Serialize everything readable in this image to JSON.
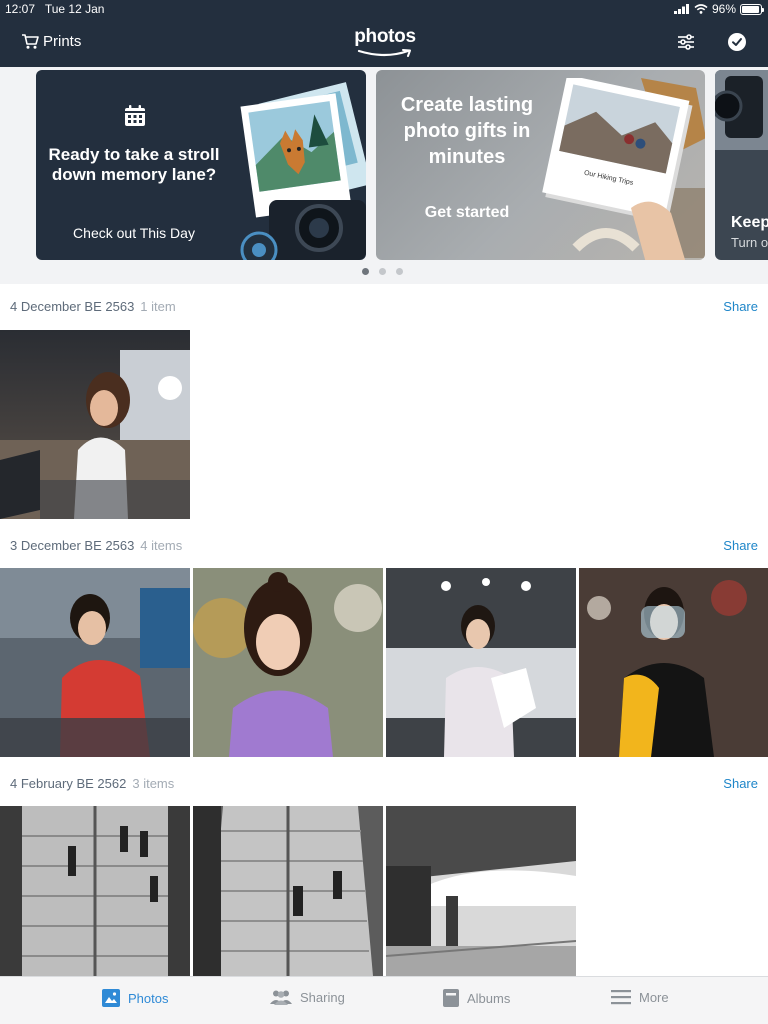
{
  "status_bar": {
    "time": "12:07",
    "date": "Tue 12 Jan",
    "battery": "96%",
    "battery_level": 0.96
  },
  "header": {
    "prints_label": "Prints",
    "logo_text": "photos",
    "filter_icon": "sliders-icon",
    "select_icon": "check-circle-icon",
    "accent": "#232f3e"
  },
  "carousel": {
    "cards": [
      {
        "title": "Ready to take a stroll down memory lane?",
        "link": "Check out This Day",
        "icon": "calendar-icon"
      },
      {
        "title": "Create lasting photo gifts in minutes",
        "link": "Get started",
        "book_title": "Our Hiking Trips"
      },
      {
        "title": "Keep",
        "subtitle": "Turn o"
      }
    ],
    "page_count": 3,
    "active_page": 1
  },
  "sections": [
    {
      "date": "4 December BE 2563",
      "count": "1 item",
      "share": "Share"
    },
    {
      "date": "3 December BE 2563",
      "count": "4 items",
      "share": "Share"
    },
    {
      "date": "4 February BE 2562",
      "count": "3 items",
      "share": "Share"
    }
  ],
  "tabs": [
    {
      "label": "Photos",
      "icon": "photo-icon",
      "active": true
    },
    {
      "label": "Sharing",
      "icon": "people-icon",
      "active": false
    },
    {
      "label": "Albums",
      "icon": "album-icon",
      "active": false
    },
    {
      "label": "More",
      "icon": "menu-icon",
      "active": false
    }
  ],
  "colors": {
    "link": "#1f86c9",
    "active_tab": "#2f8ad6",
    "inactive_tab": "#8c9298"
  }
}
